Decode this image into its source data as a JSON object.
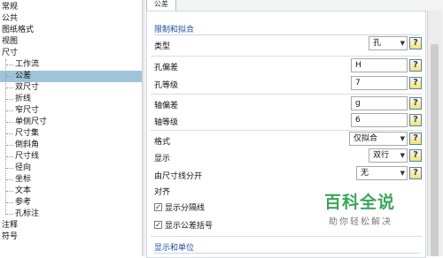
{
  "tree": {
    "items": [
      {
        "label": "常规",
        "indent": 0
      },
      {
        "label": "公共",
        "indent": 0
      },
      {
        "label": "图纸格式",
        "indent": 0
      },
      {
        "label": "视图",
        "indent": 0
      },
      {
        "label": "尺寸",
        "indent": 0,
        "expanded": true
      },
      {
        "label": "工作流",
        "indent": 1
      },
      {
        "label": "公差",
        "indent": 1,
        "selected": true
      },
      {
        "label": "双尺寸",
        "indent": 1
      },
      {
        "label": "折线",
        "indent": 1
      },
      {
        "label": "窄尺寸",
        "indent": 1
      },
      {
        "label": "单侧尺寸",
        "indent": 1
      },
      {
        "label": "尺寸集",
        "indent": 1
      },
      {
        "label": "倒斜角",
        "indent": 1
      },
      {
        "label": "尺寸线",
        "indent": 1
      },
      {
        "label": "径向",
        "indent": 1
      },
      {
        "label": "坐标",
        "indent": 1
      },
      {
        "label": "文本",
        "indent": 1
      },
      {
        "label": "参考",
        "indent": 1
      },
      {
        "label": "孔标注",
        "indent": 1
      },
      {
        "label": "注释",
        "indent": 0
      },
      {
        "label": "符号",
        "indent": 0
      }
    ]
  },
  "tab_label": "公差",
  "section1": {
    "title": "限制和拟合",
    "type_label": "类型",
    "type_value": "孔",
    "hole_dev_label": "孔偏差",
    "hole_dev_value": "H",
    "hole_grade_label": "孔等级",
    "hole_grade_value": "7",
    "shaft_dev_label": "轴偏差",
    "shaft_dev_value": "g",
    "shaft_grade_label": "轴等级",
    "shaft_grade_value": "6",
    "format_label": "格式",
    "format_value": "仅拟合",
    "display_label": "显示",
    "display_value": "双行",
    "split_label": "由尺寸线分开",
    "split_value": "无",
    "align_label": "对齐",
    "chk_separator_label": "显示分隔线",
    "chk_separator_checked": true,
    "chk_brackets_label": "显示公差括号",
    "chk_brackets_checked": true
  },
  "section2": {
    "title": "显示和单位"
  },
  "help_glyph": "?",
  "watermark": {
    "title": "百科全说",
    "subtitle": "助你轻松解决"
  },
  "colors": {
    "selected_row": "#9fc3d9",
    "section_title": "#1a4d9c",
    "watermark_green": "#3ba55c"
  }
}
